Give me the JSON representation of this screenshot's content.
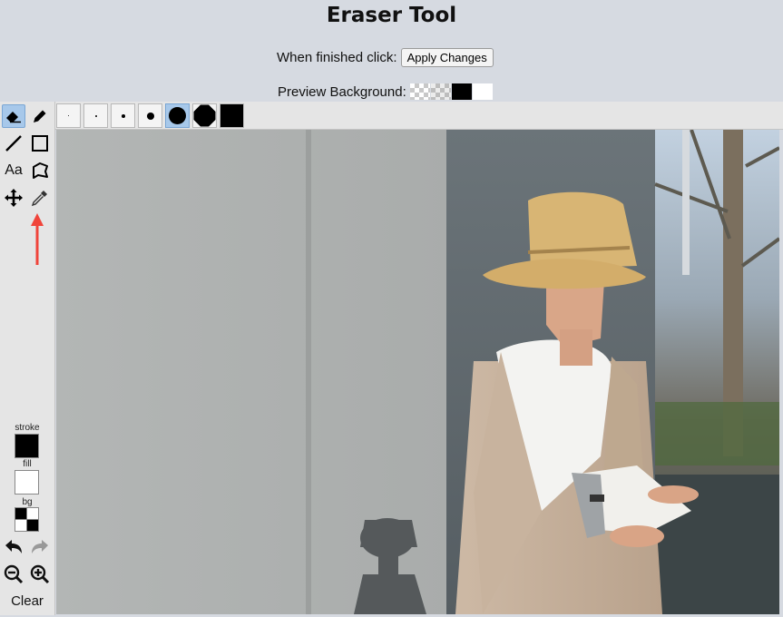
{
  "header": {
    "title": "Eraser Tool",
    "apply_prompt": "When finished click:",
    "apply_button": "Apply Changes",
    "preview_label": "Preview Background:",
    "preview_options": [
      "transparent-checker",
      "gray-checker",
      "black",
      "white"
    ]
  },
  "toolbar": {
    "tools": [
      {
        "name": "eraser",
        "icon": "eraser-icon",
        "active": true
      },
      {
        "name": "pencil",
        "icon": "pencil-icon"
      },
      {
        "name": "line",
        "icon": "line-icon"
      },
      {
        "name": "rectangle",
        "icon": "rectangle-icon"
      },
      {
        "name": "text",
        "icon": "text-icon",
        "label": "Aa"
      },
      {
        "name": "polygon-select",
        "icon": "polygon-select-icon"
      },
      {
        "name": "move",
        "icon": "move-icon"
      },
      {
        "name": "color-picker",
        "icon": "eyedropper-icon"
      }
    ],
    "stroke_label": "stroke",
    "fill_label": "fill",
    "bg_label": "bg",
    "stroke_color": "#000000",
    "fill_color": "#ffffff",
    "clear_label": "Clear"
  },
  "brush_sizes": [
    "size-1",
    "size-2",
    "size-3",
    "size-4",
    "size-5",
    "size-6",
    "size-7"
  ],
  "active_brush_size_index": 4,
  "colors": {
    "active": "#a7c8ea",
    "annotation_arrow": "#f0443a"
  }
}
